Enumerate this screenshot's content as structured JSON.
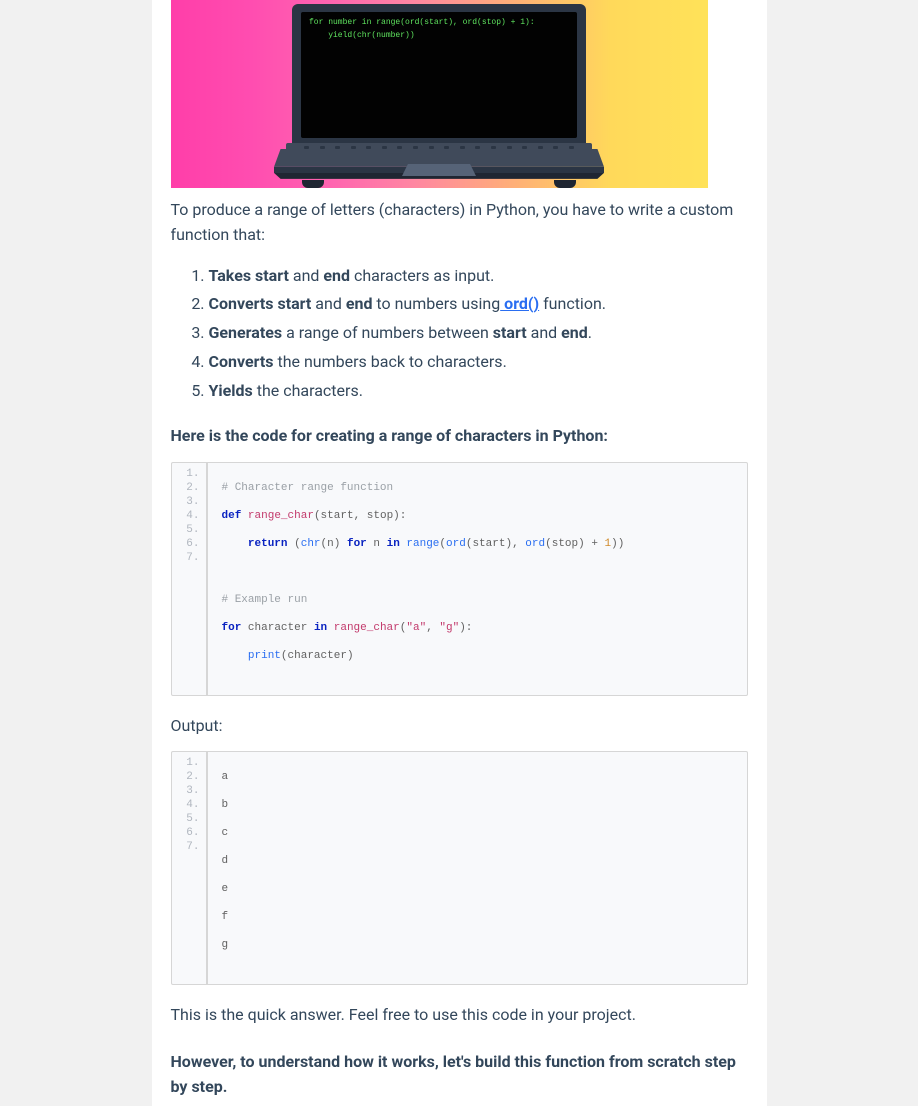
{
  "hero": {
    "code_line1": "for number in range(ord(start), ord(stop) + 1):",
    "code_line2": "    yield(chr(number))"
  },
  "intro_text_pre": "To produce a range of letters (characters) in Python, you have to write a custom function that:",
  "steps": [
    {
      "b": "Takes start",
      "mid1": " and ",
      "b2": "end",
      "tail": " characters as input."
    },
    {
      "b": "Converts start",
      "mid1": " and ",
      "b2": "end",
      "mid2": " to numbers using",
      "link": " ord()",
      "tail": " function."
    },
    {
      "b": "Generates",
      "mid1": " a range of numbers between ",
      "b2": "start",
      "mid2": " and ",
      "b3": "end",
      "tail": "."
    },
    {
      "b": "Converts",
      "tail": " the numbers back to characters."
    },
    {
      "b": "Yields",
      "tail": " the characters."
    }
  ],
  "subheading1": "Here is the code for creating a range of characters in Python:",
  "code1": {
    "line_numbers": [
      "1.",
      "2.",
      "3.",
      "4.",
      "5.",
      "6.",
      "7."
    ],
    "l1_comment": "# Character range function",
    "l2_def": "def",
    "l2_name": "range_char",
    "l2_paren_open": "(",
    "l2_p1": "start",
    "l2_comma1": ", ",
    "l2_p2": "stop",
    "l2_close": "):",
    "l3_indent": "    ",
    "l3_return": "return",
    "l3_sp": " ",
    "l3_popen": "(",
    "l3_chr": "chr",
    "l3_po2": "(",
    "l3_n": "n",
    "l3_pc2": ") ",
    "l3_for": "for",
    "l3_sp2": " n ",
    "l3_in": "in",
    "l3_sp3": " ",
    "l3_range": "range",
    "l3_po3": "(",
    "l3_ord1": "ord",
    "l3_po4": "(",
    "l3_start": "start",
    "l3_pc4": "), ",
    "l3_ord2": "ord",
    "l3_po5": "(",
    "l3_stop": "stop",
    "l3_pc5": ") ",
    "l3_plus": "+",
    "l3_sp4": " ",
    "l3_one": "1",
    "l3_pc_all": "))",
    "l4_blank": "",
    "l5_comment": "# Example run",
    "l6_for": "for",
    "l6_mid": " character ",
    "l6_in": "in",
    "l6_sp": " ",
    "l6_fn": "range_char",
    "l6_po": "(",
    "l6_s1": "\"a\"",
    "l6_comma": ", ",
    "l6_s2": "\"g\"",
    "l6_close": "):",
    "l7_indent": "    ",
    "l7_print": "print",
    "l7_po": "(",
    "l7_arg": "character",
    "l7_pc": ")"
  },
  "output_label": "Output:",
  "code2": {
    "line_numbers": [
      "1.",
      "2.",
      "3.",
      "4.",
      "5.",
      "6.",
      "7."
    ],
    "lines": [
      "a",
      "b",
      "c",
      "d",
      "e",
      "f",
      "g"
    ]
  },
  "quick_answer": "This is the quick answer. Feel free to use this code in your project.",
  "subheading2": "However, to understand how it works, let's build this function from scratch step by step."
}
